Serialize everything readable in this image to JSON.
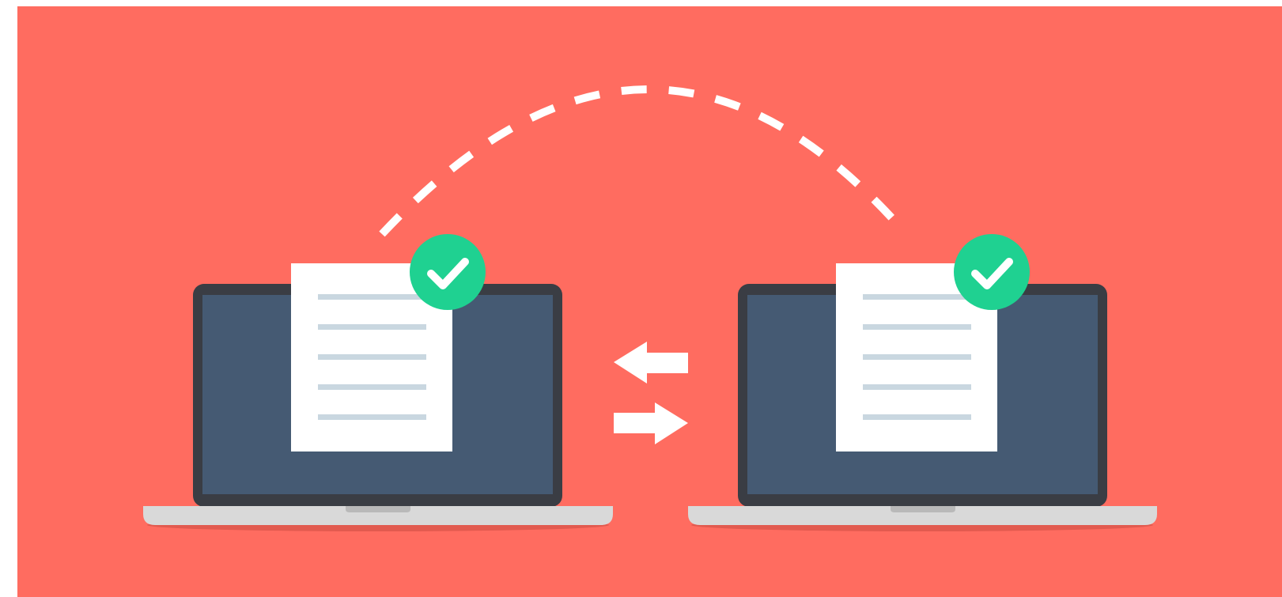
{
  "scene": {
    "description_icons": [
      "laptop-icon",
      "document-icon",
      "check-badge-icon",
      "arrow-left-icon",
      "arrow-right-icon",
      "dashed-arc"
    ],
    "colors": {
      "background": "#FF6C60",
      "frame": "#FFFFFF",
      "laptop_bezel": "#3A3D44",
      "laptop_screen": "#455A73",
      "laptop_base": "#D9D9D9",
      "laptop_base_shadow": "#E25A4F",
      "laptop_notch": "#B9B9B9",
      "document": "#FFFFFF",
      "document_lines": "#C9D7E0",
      "check_badge": "#1FD191",
      "check_mark": "#FFFFFF",
      "arrows": "#FFFFFF",
      "arc": "#FFFFFF"
    }
  }
}
